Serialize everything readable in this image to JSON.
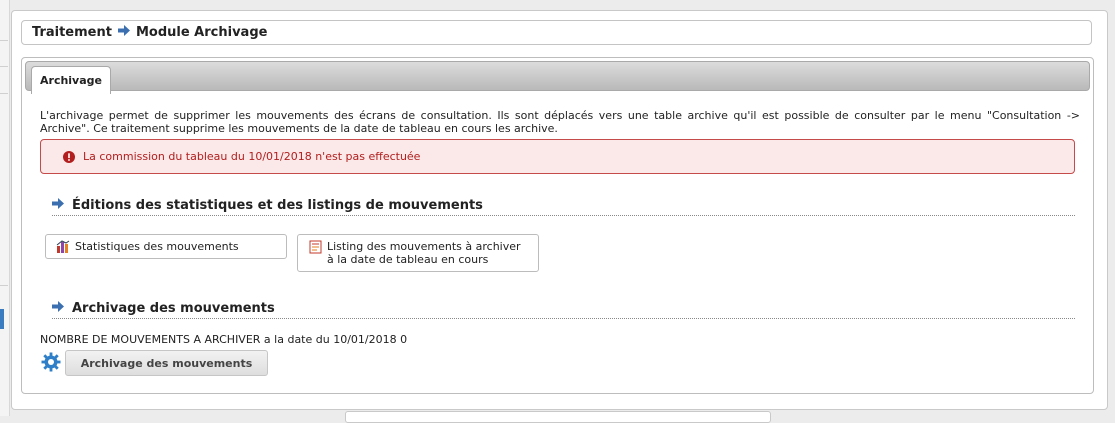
{
  "breadcrumb": {
    "root": "Traitement",
    "current": "Module Archivage"
  },
  "tabs": [
    {
      "label": "Archivage",
      "active": true
    }
  ],
  "intro": "L'archivage permet de supprimer les mouvements des écrans de consultation. Ils sont déplacés vers une table archive qu'il est possible de consulter par le menu \"Consultation -> Archive\". Ce traitement supprime les mouvements de la date de tableau en cours les archive.",
  "error": {
    "message": "La commission du tableau du 10/01/2018 n'est pas effectuée"
  },
  "section_editions": {
    "title": "Éditions des statistiques et des listings de mouvements",
    "buttons": [
      {
        "label": "Statistiques des mouvements",
        "icon": "chart-icon"
      },
      {
        "label": "Listing des mouvements à archiver",
        "label2": "à la date de tableau en cours",
        "icon": "pdf-list-icon"
      }
    ]
  },
  "section_archive": {
    "title": "Archivage des mouvements",
    "count_text": "NOMBRE DE MOUVEMENTS A ARCHIVER a la date du 10/01/2018 0",
    "button_label": "Archivage des mouvements"
  },
  "colors": {
    "error_bg": "#fbe8e8",
    "error_border": "#c54a4a",
    "error_text": "#b21e1e",
    "arrow": "#3b6fb0"
  }
}
